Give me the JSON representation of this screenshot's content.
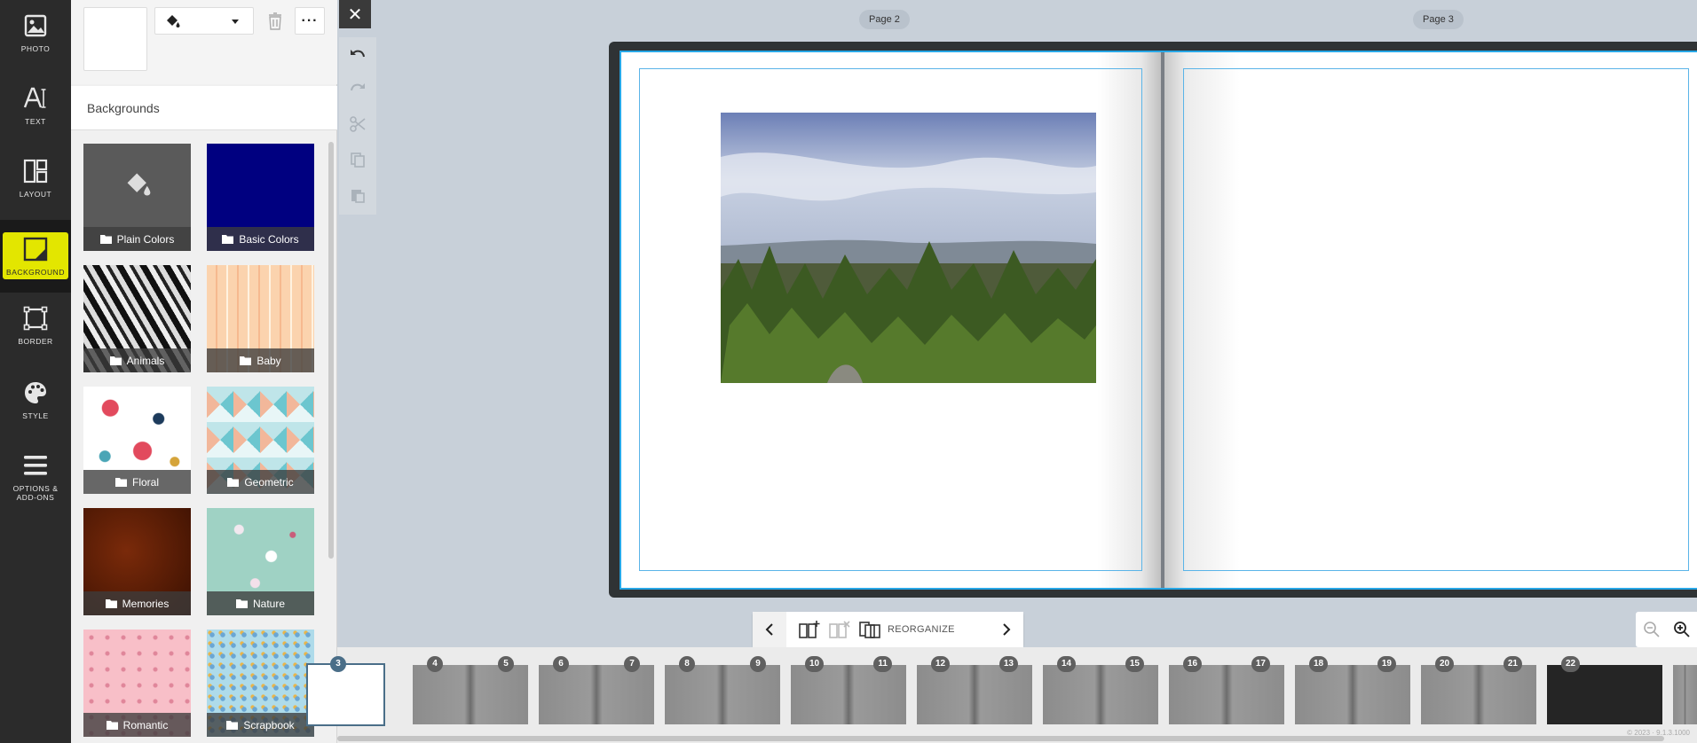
{
  "rail": {
    "items": [
      {
        "label": "PHOTO"
      },
      {
        "label": "TEXT"
      },
      {
        "label": "LAYOUT"
      },
      {
        "label": "BACKGROUND"
      },
      {
        "label": "BORDER"
      },
      {
        "label": "STYLE"
      },
      {
        "label": "OPTIONS &",
        "label2": "ADD-ONS"
      }
    ],
    "active": "BACKGROUND",
    "highlight_color": "#e3e600"
  },
  "panel": {
    "title": "Backgrounds",
    "fill_icon": "paint-bucket-icon",
    "tiles": [
      {
        "label": "Plain Colors"
      },
      {
        "label": "Basic Colors"
      },
      {
        "label": "Animals"
      },
      {
        "label": "Baby"
      },
      {
        "label": "Floral"
      },
      {
        "label": "Geometric"
      },
      {
        "label": "Memories"
      },
      {
        "label": "Nature"
      },
      {
        "label": "Romantic"
      },
      {
        "label": "Scrapbook"
      }
    ]
  },
  "pages": {
    "left_label": "Page 2",
    "right_label": "Page 3"
  },
  "pagenav": {
    "reorganize_label": "REORGANIZE"
  },
  "filmstrip": {
    "current": "3",
    "spreads": [
      {
        "left": "",
        "right": "3"
      },
      {
        "left": "4",
        "right": "5"
      },
      {
        "left": "6",
        "right": "7"
      },
      {
        "left": "8",
        "right": "9"
      },
      {
        "left": "10",
        "right": "11"
      },
      {
        "left": "12",
        "right": "13"
      },
      {
        "left": "14",
        "right": "15"
      },
      {
        "left": "16",
        "right": "17"
      },
      {
        "left": "18",
        "right": "19"
      },
      {
        "left": "20",
        "right": "21"
      },
      {
        "left": "22",
        "right": ""
      }
    ]
  },
  "footer": {
    "copyright": "© 2023 · 9.1.3.1000"
  },
  "colors": {
    "accent": "#27a7e6",
    "rail": "#2b2b2b"
  }
}
